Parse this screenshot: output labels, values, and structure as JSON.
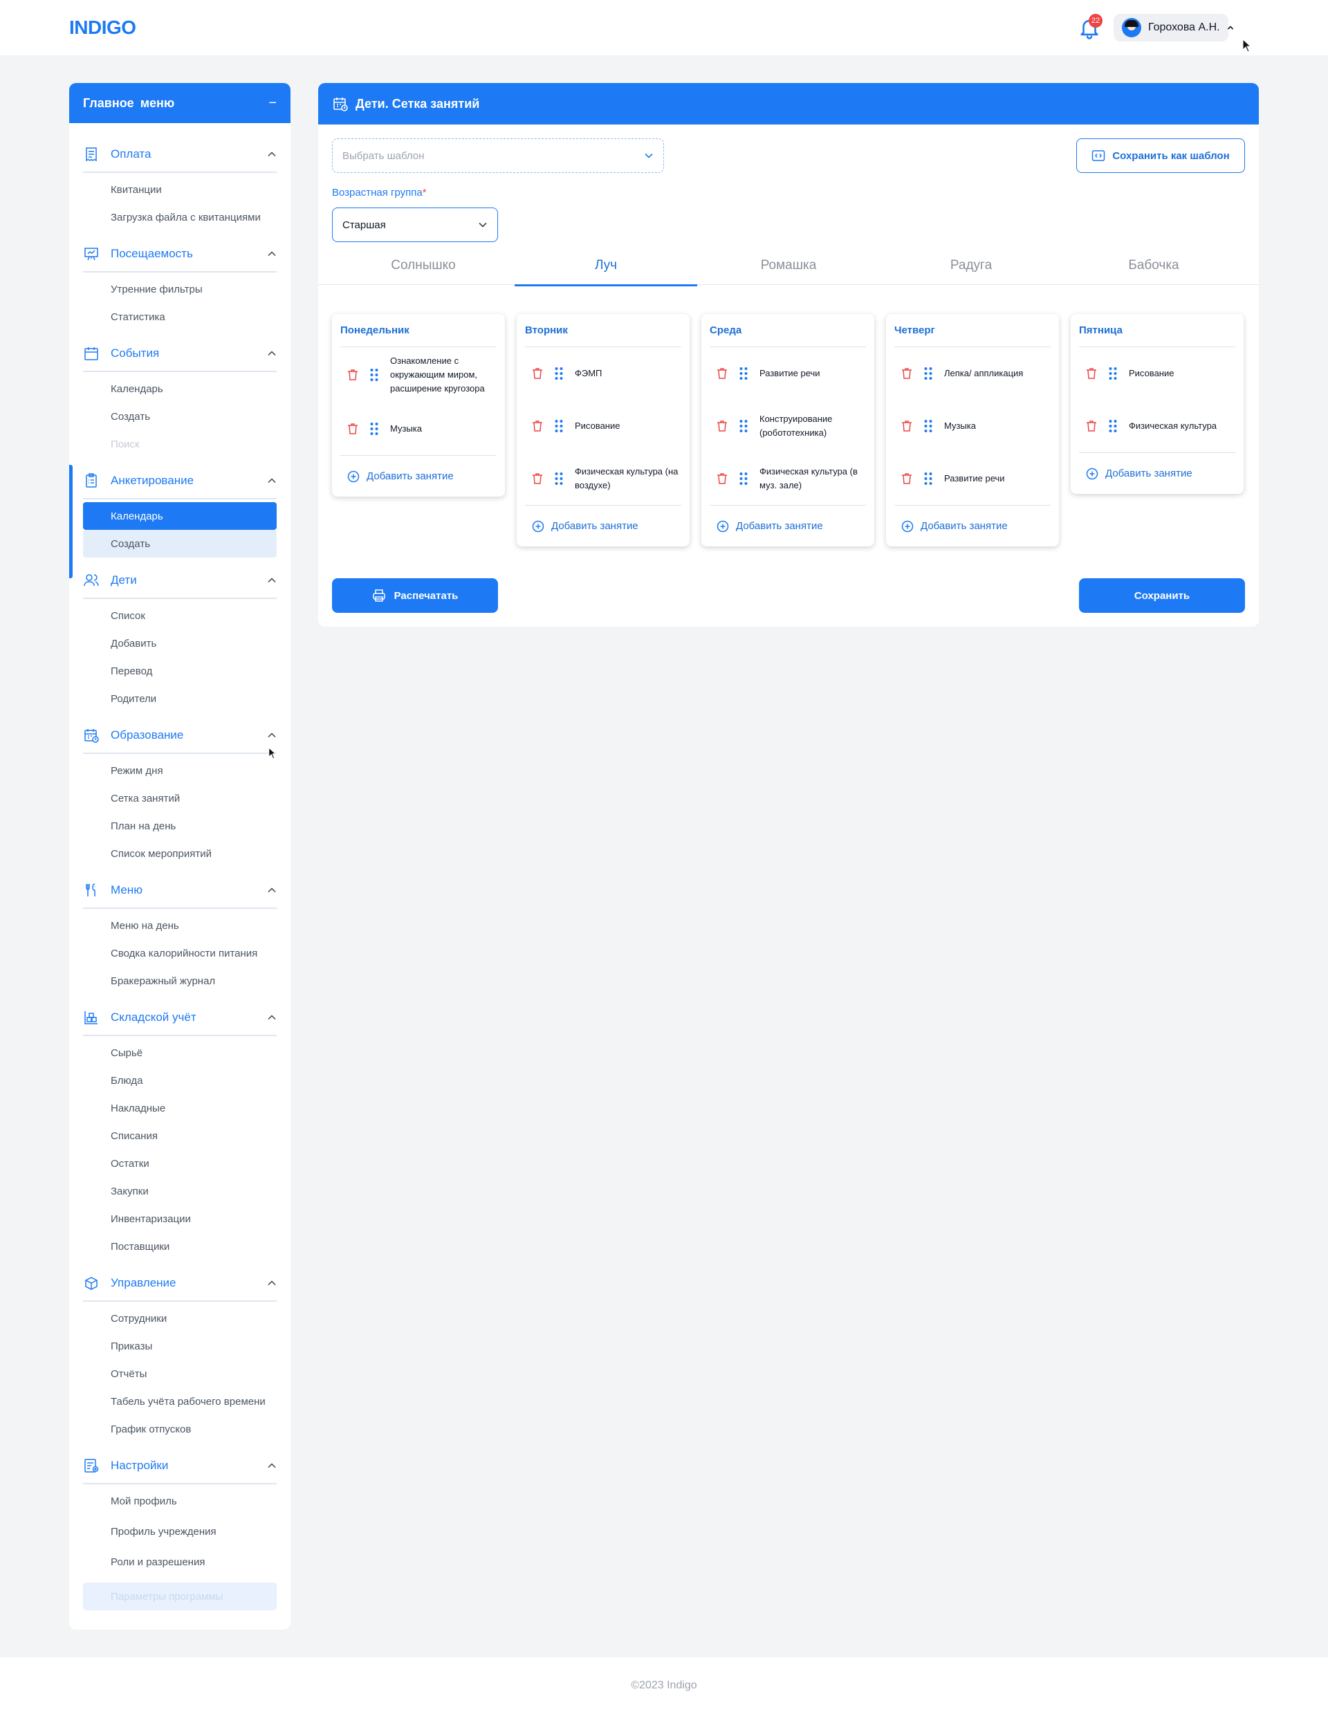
{
  "header": {
    "logo": "INDIGO",
    "notifications_count": "22",
    "user_name": "Горохова А.Н."
  },
  "sidebar": {
    "title": "Главное меню",
    "collapse_symbol": "−",
    "sections": [
      {
        "label": "Оплата",
        "icon": "receipt-icon",
        "items": [
          "Квитанции",
          "Загрузка файла с квитанциями"
        ]
      },
      {
        "label": "Посещаемость",
        "icon": "presentation-chart-icon",
        "items": [
          "Утренние фильтры",
          "Статистика"
        ]
      },
      {
        "label": "События",
        "icon": "calendar-icon",
        "items": [
          "Календарь",
          "Создать",
          "Поиск"
        ]
      },
      {
        "label": "Анкетирование",
        "icon": "clipboard-icon",
        "items": [
          "Календарь",
          "Создать"
        ]
      },
      {
        "label": "Дети",
        "icon": "users-icon",
        "items": [
          "Список",
          "Добавить",
          "Перевод",
          "Родители"
        ]
      },
      {
        "label": "Образование",
        "icon": "calendar-clock-icon",
        "items": [
          "Режим дня",
          "Сетка занятий",
          "План на день",
          "Список мероприятий"
        ]
      },
      {
        "label": "Меню",
        "icon": "cutlery-icon",
        "items": [
          "Меню на день",
          "Сводка калорийности питания",
          "Бракеражный журнал"
        ]
      },
      {
        "label": "Складской учёт",
        "icon": "warehouse-icon",
        "items": [
          "Сырьё",
          "Блюда",
          "Накладные",
          "Списания",
          "Остатки",
          "Закупки",
          "Инвентаризации",
          "Поставщики"
        ]
      },
      {
        "label": "Управление",
        "icon": "box-icon",
        "items": [
          "Сотрудники",
          "Приказы",
          "Отчёты",
          "Табель учёта рабочего времени",
          "График отпусков"
        ]
      },
      {
        "label": "Настройки",
        "icon": "settings-list-icon",
        "items": [
          "Мой профиль",
          "Профиль учреждения",
          "Роли и разрешения",
          "Параметры программы"
        ]
      }
    ]
  },
  "main": {
    "title": "Дети. Сетка занятий",
    "template_placeholder": "Выбрать шаблон",
    "save_template_label": "Сохранить как шаблон",
    "age_group_label": "Возрастная группа",
    "age_group_required": "*",
    "age_group_value": "Старшая",
    "tabs": [
      "Солнышко",
      "Луч",
      "Ромашка",
      "Радуга",
      "Бабочка"
    ],
    "active_tab": "Луч",
    "add_lesson_label": "Добавить занятие",
    "days": [
      {
        "name": "Понедельник",
        "lessons": [
          "Ознакомление с окружающим миром, расширение кругозора",
          "Музыка"
        ]
      },
      {
        "name": "Вторник",
        "lessons": [
          "ФЭМП",
          "Рисование",
          "Физическая культура (на воздухе)"
        ]
      },
      {
        "name": "Среда",
        "lessons": [
          "Развитие речи",
          "Конструирование (робототехника)",
          "Физическая культура (в муз. зале)"
        ]
      },
      {
        "name": "Четверг",
        "lessons": [
          "Лепка/ аппликация",
          "Музыка",
          "Развитие речи"
        ]
      },
      {
        "name": "Пятница",
        "lessons": [
          "Рисование",
          "Физическая культура"
        ]
      }
    ],
    "print_label": "Распечатать",
    "save_label": "Сохранить"
  },
  "footer": {
    "text": "©2023 Indigo"
  },
  "colors": {
    "accent": "#1d7af4",
    "danger": "#ef4444",
    "background": "#f3f4f6"
  }
}
